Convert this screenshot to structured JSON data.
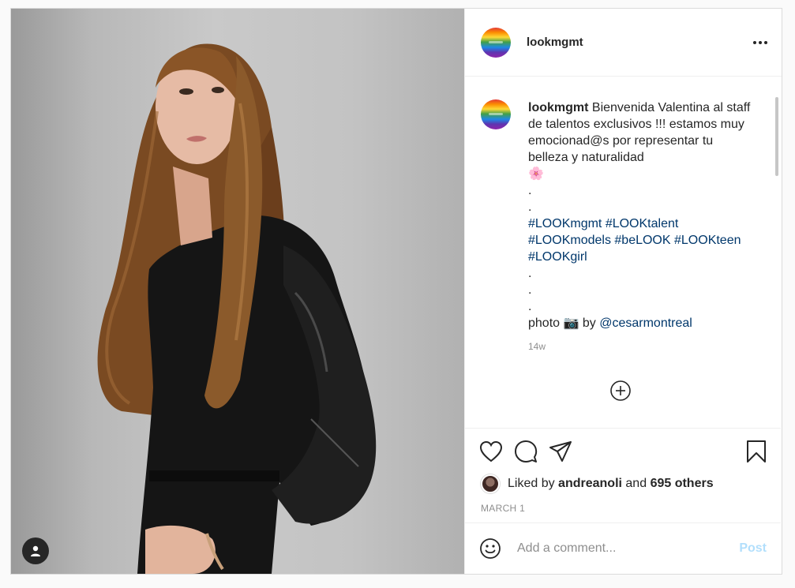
{
  "post": {
    "username": "lookmgmt",
    "caption": {
      "username": "lookmgmt",
      "lines": [
        "Bienvenida Valentina al",
        "staff de talentos exclusivos !!!",
        "estamos muy emocionad@s por",
        "representar tu belleza y naturalidad"
      ],
      "emoji": "🌸",
      "dots_before": [
        ".",
        "."
      ],
      "hashtags_line1": [
        "#LOOKmgmt",
        "#LOOKtalent"
      ],
      "hashtags_line2": [
        "#LOOKmodels",
        "#beLOOK",
        "#LOOKteen"
      ],
      "hashtags_line3": [
        "#LOOKgirl"
      ],
      "dots_after": [
        ".",
        ".",
        "."
      ],
      "credit_prefix": "photo",
      "credit_emoji": "📷",
      "credit_by": "by",
      "credit_mention": "@cesarmontreal"
    },
    "time_ago": "14w",
    "likes": {
      "prefix": "Liked by",
      "user": "andreanoli",
      "and": "and",
      "others": "695 others"
    },
    "date": "MARCH 1",
    "comment_placeholder": "Add a comment...",
    "post_label": "Post"
  },
  "icons": {
    "more": "more-options-icon",
    "like": "heart-icon",
    "comment": "comment-icon",
    "share": "share-icon",
    "save": "bookmark-icon",
    "emoji": "emoji-icon",
    "load_more": "plus-circle-icon",
    "tagged": "user-icon"
  },
  "colors": {
    "text": "#262626",
    "link": "#00376b",
    "muted": "#8e8e8e",
    "post_disabled": "#b2dffc"
  }
}
